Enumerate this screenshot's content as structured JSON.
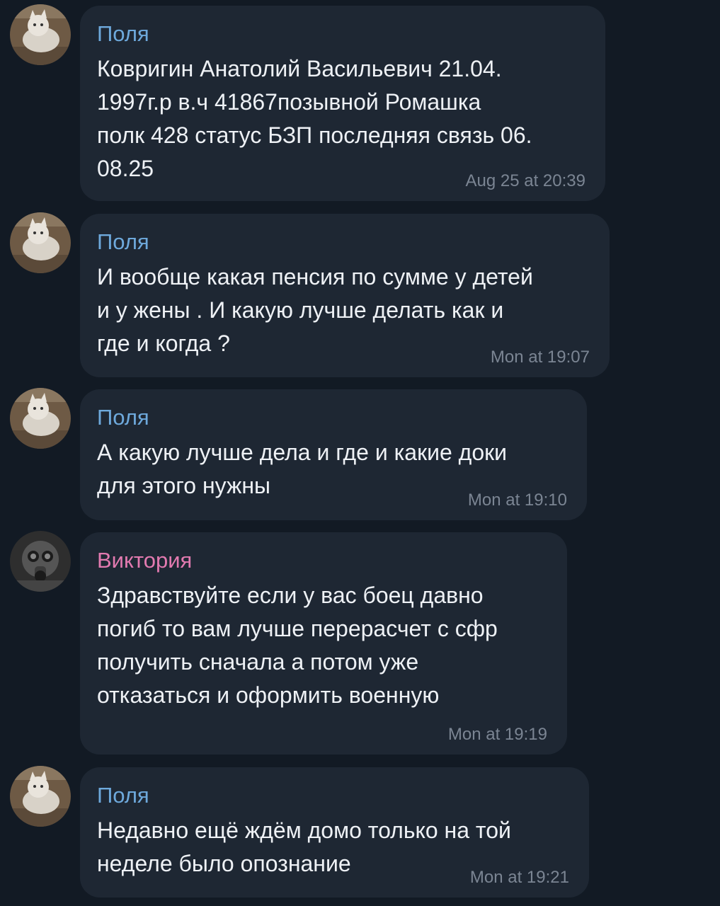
{
  "messages": [
    {
      "sender": "Поля",
      "text": "Ковригин Анатолий Васильевич 21.04.\n1997г.р в.ч 41867позывной Ромашка\nполк 428 статус БЗП последняя связь 06.\n08.25",
      "time": "Aug 25 at 20:39",
      "avatar": "cat-avatar"
    },
    {
      "sender": "Поля",
      "text": "И вообще какая пенсия по сумме у детей\nи у жены . И какую лучше делать как и\nгде и когда ?",
      "time": "Mon at 19:07",
      "avatar": "cat-avatar"
    },
    {
      "sender": "Поля",
      "text": "А какую лучше дела и где и какие доки\nдля этого нужны",
      "time": "Mon at 19:10",
      "avatar": "cat-avatar"
    },
    {
      "sender": "Виктория",
      "text": "Здравствуйте если у вас боец давно\nпогиб то вам лучше перерасчет с сфр\nполучить сначала а потом уже\nотказаться и оформить военную",
      "time": "Mon at 19:19",
      "avatar": "gasmask-avatar"
    },
    {
      "sender": "Поля",
      "text": "Недавно ещё ждём домо только на той\nнеделе было опознание",
      "time": "Mon at 19:21",
      "avatar": "cat-avatar"
    }
  ],
  "colors": {
    "background": "#121a24",
    "bubble": "#1e2733",
    "sender_blue": "#6ea9dc",
    "sender_pink": "#e27ab0",
    "text": "#eef1f5",
    "time": "#7b8593"
  }
}
